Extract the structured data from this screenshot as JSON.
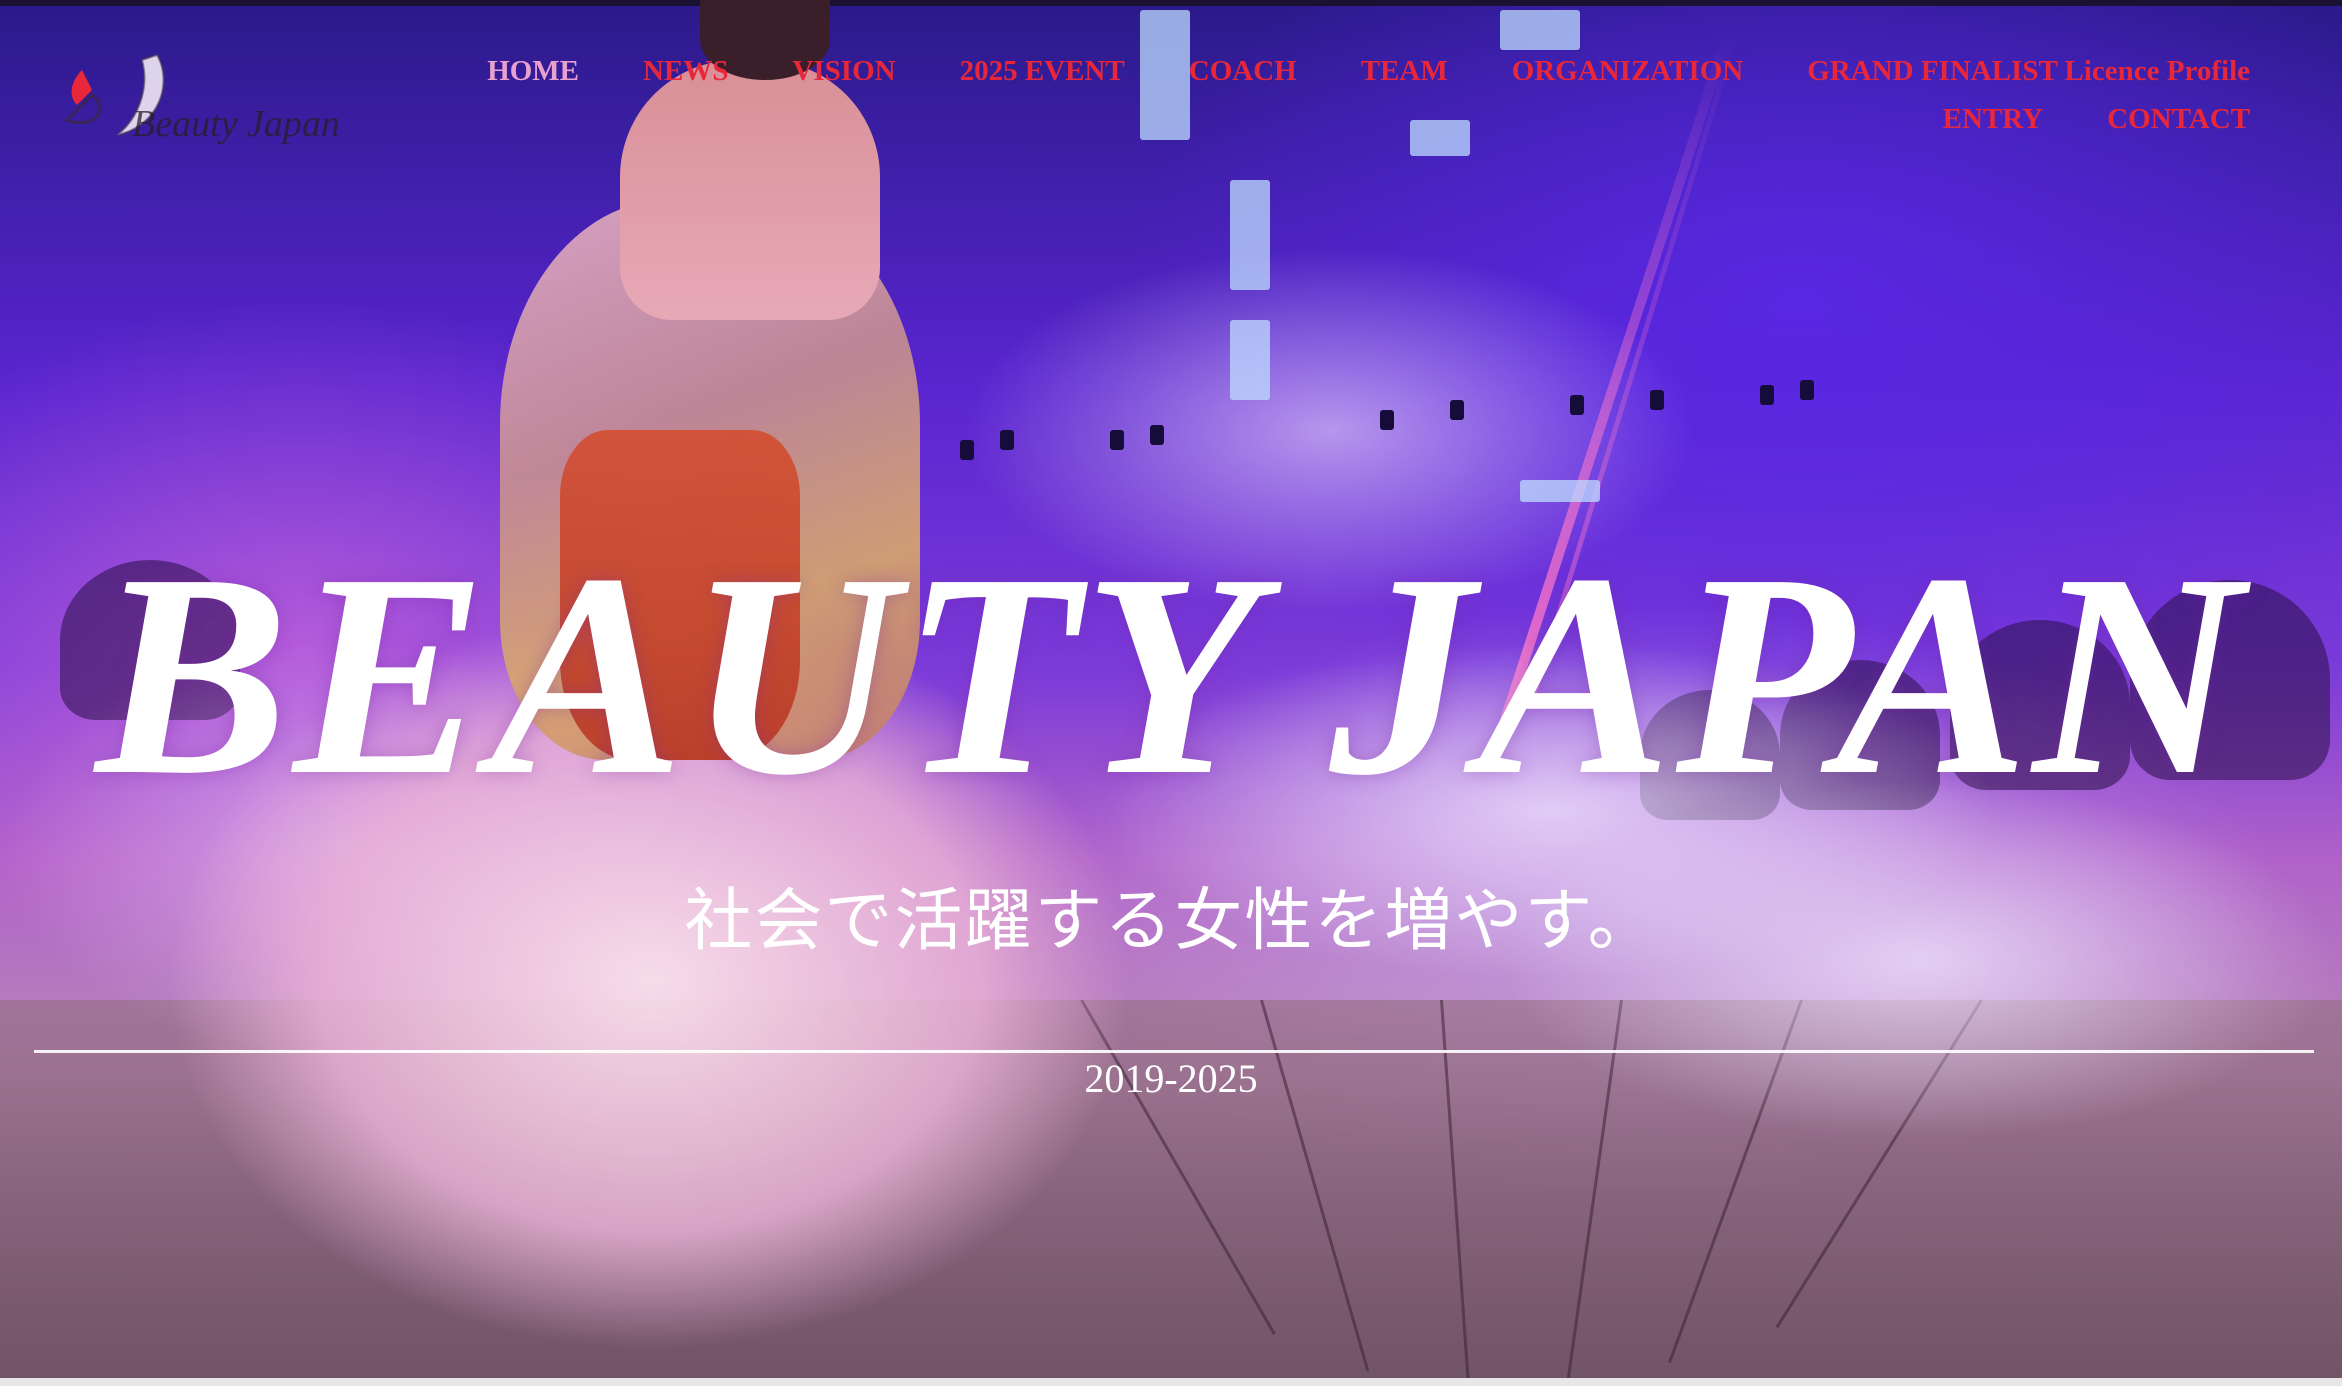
{
  "site": {
    "logo_text": "Beauty Japan",
    "logo_icon": "bj-logo-icon"
  },
  "nav": {
    "items": [
      {
        "label": "HOME",
        "active": true
      },
      {
        "label": "NEWS"
      },
      {
        "label": "VISION"
      },
      {
        "label": "2025 EVENT"
      },
      {
        "label": "COACH"
      },
      {
        "label": "TEAM"
      },
      {
        "label": "ORGANIZATION"
      },
      {
        "label": "GRAND FINALIST Licence Profile"
      },
      {
        "label": "ENTRY"
      },
      {
        "label": "CONTACT"
      }
    ]
  },
  "hero": {
    "title": "BEAUTY JAPAN",
    "tagline": "社会で活躍する女性を増やす。",
    "years": "2019-2025"
  },
  "colors": {
    "nav_link": "#e8273a",
    "nav_active": "#e9a0d0",
    "hero_text": "#ffffff",
    "logo_accent": "#e8273a"
  }
}
